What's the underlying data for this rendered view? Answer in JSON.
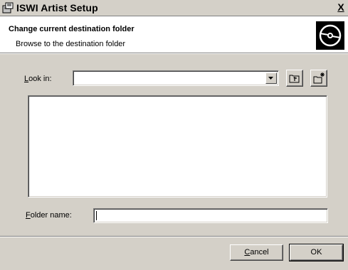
{
  "window": {
    "title": "ISWI Artist Setup",
    "close_label": "X"
  },
  "banner": {
    "title": "Change current destination folder",
    "subtitle": "Browse to the destination folder"
  },
  "look_in": {
    "label_first": "L",
    "label_rest": "ook in:",
    "value": ""
  },
  "folder_name": {
    "label_first": "F",
    "label_rest": "older name:",
    "value": ""
  },
  "buttons": {
    "cancel_first": "C",
    "cancel_rest": "ancel",
    "ok_label": "OK"
  },
  "icons": {
    "window_icon": "setup-window-icon",
    "banner_logo": "disc-icon",
    "up_folder": "up-one-level-icon",
    "new_folder": "new-folder-icon",
    "dropdown": "chevron-down-icon"
  }
}
